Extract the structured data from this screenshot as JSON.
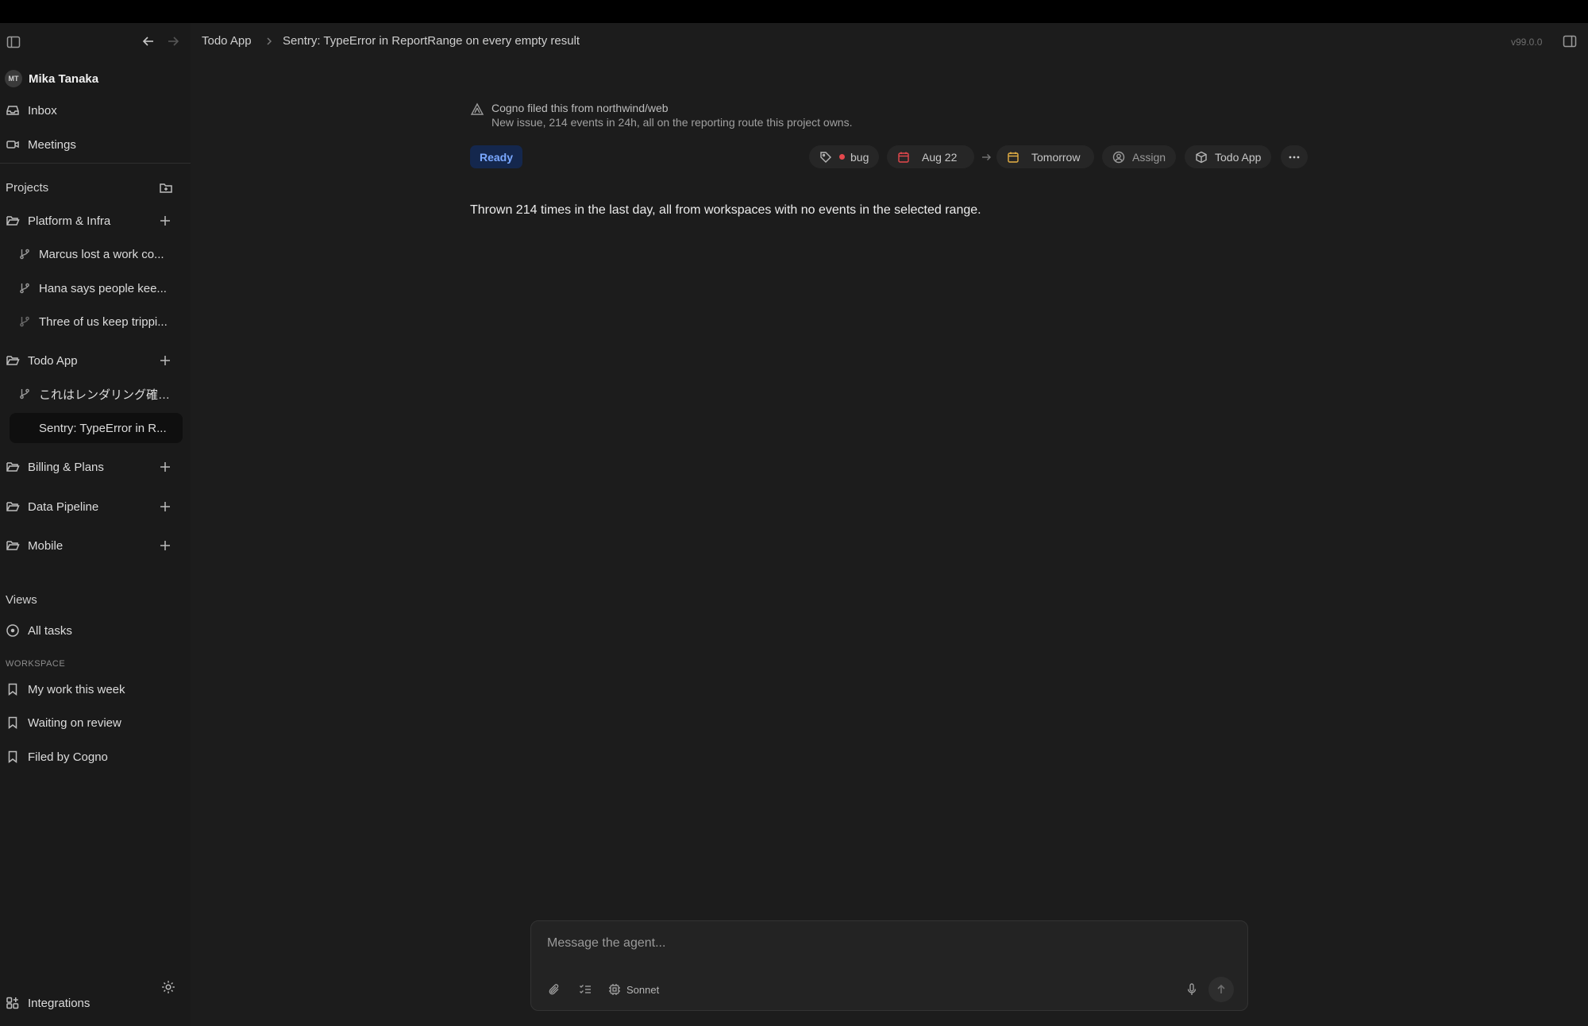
{
  "user": {
    "initials": "MT",
    "name": "Mika Tanaka"
  },
  "nav": {
    "inbox": "Inbox",
    "meetings": "Meetings"
  },
  "projects": {
    "label": "Projects",
    "groups": [
      {
        "name": "Platform & Infra",
        "items": [
          "Marcus lost a work co...",
          "Hana says people kee...",
          "Three of us keep trippi..."
        ]
      },
      {
        "name": "Todo App",
        "items": [
          "これはレンダリング確認...",
          "Sentry: TypeError in R..."
        ]
      },
      {
        "name": "Billing & Plans",
        "items": []
      },
      {
        "name": "Data Pipeline",
        "items": []
      },
      {
        "name": "Mobile",
        "items": []
      }
    ]
  },
  "views": {
    "label": "Views",
    "all_tasks": "All tasks",
    "workspace_label": "WORKSPACE",
    "saved": [
      "My work this week",
      "Waiting on review",
      "Filed by Cogno"
    ]
  },
  "footer": {
    "integrations": "Integrations"
  },
  "breadcrumb": {
    "project": "Todo App",
    "issue": "Sentry: TypeError in ReportRange on every empty result"
  },
  "version": "v99.0.0",
  "issue": {
    "filed_by": "Cogno filed this from northwind/web",
    "filed_detail": "New issue, 214 events in 24h, all on the reporting route this project owns.",
    "status": "Ready",
    "label": "bug",
    "start_date": "Aug 22",
    "due_date": "Tomorrow",
    "assign": "Assign",
    "project": "Todo App",
    "body": "Thrown 214 times in the last day, all from workspaces with no events in the selected range."
  },
  "composer": {
    "placeholder": "Message the agent...",
    "model": "Sonnet"
  },
  "colors": {
    "status_bg": "#14274d",
    "status_text": "#7aa8ff",
    "bug_dot": "#e5484d",
    "date_red": "#e5484d",
    "date_yellow": "#e5b045"
  }
}
